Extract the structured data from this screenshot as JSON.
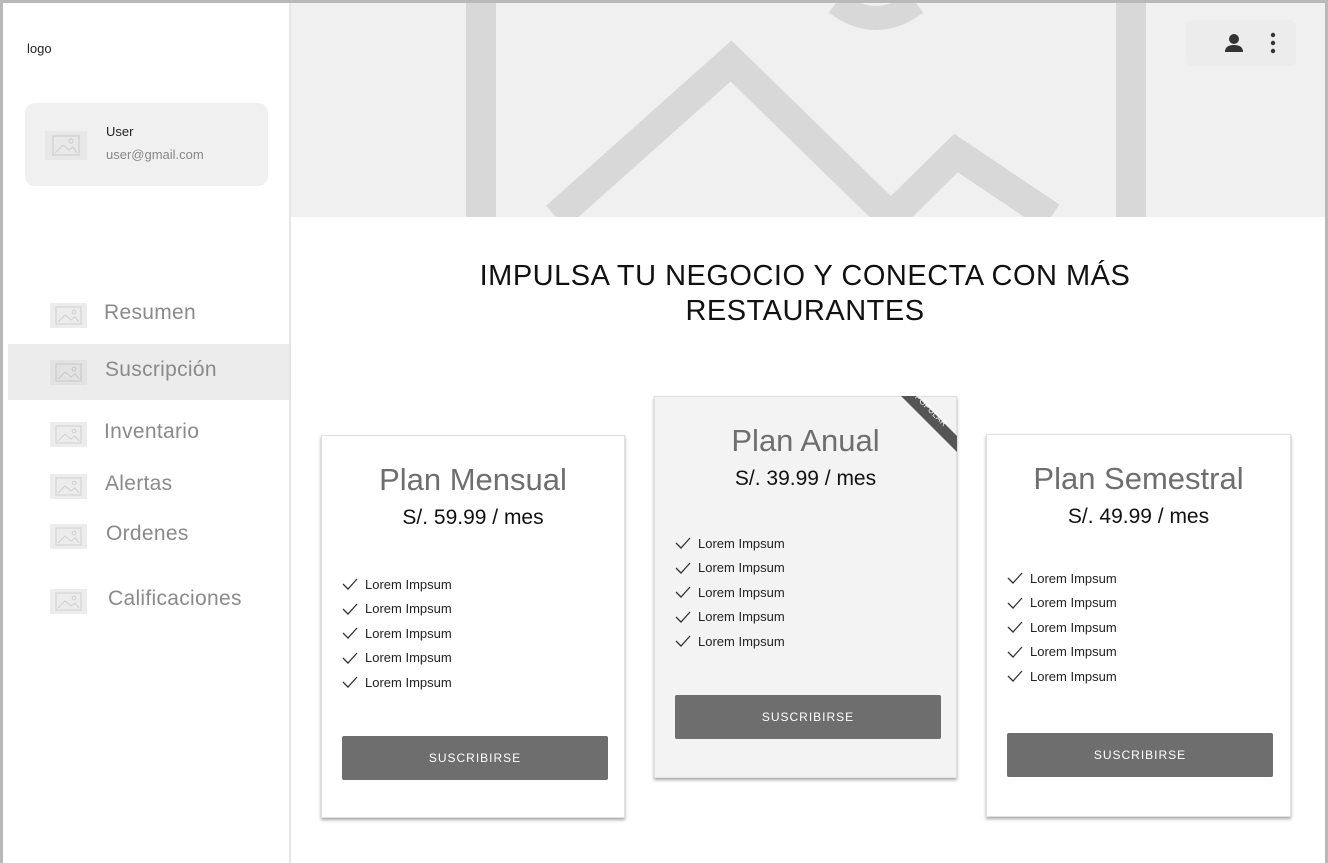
{
  "sidebar": {
    "logo": "logo",
    "user": {
      "name": "User",
      "email": "user@gmail.com"
    },
    "items": [
      {
        "label": "Resumen",
        "active": false
      },
      {
        "label": "Suscripción",
        "active": true
      },
      {
        "label": "Inventario",
        "active": false
      },
      {
        "label": "Alertas",
        "active": false
      },
      {
        "label": "Ordenes",
        "active": false
      },
      {
        "label": "Calificaciones",
        "active": false
      }
    ]
  },
  "header": {
    "icons": [
      "user-icon",
      "more-vertical-icon"
    ]
  },
  "main": {
    "headline": "IMPULSA TU NEGOCIO Y CONECTA CON MÁS RESTAURANTES",
    "plans": [
      {
        "name": "Plan Mensual",
        "price": "S/. 59.99 / mes",
        "features": [
          "Lorem Impsum",
          "Lorem Impsum",
          "Lorem Impsum",
          "Lorem Impsum",
          "Lorem Impsum"
        ],
        "button": "SUSCRIBIRSE"
      },
      {
        "name": "Plan Anual",
        "price": "S/. 39.99 / mes",
        "badge": "POPULAR",
        "features": [
          "Lorem Impsum",
          "Lorem Impsum",
          "Lorem Impsum",
          "Lorem Impsum",
          "Lorem Impsum"
        ],
        "button": "SUSCRIBIRSE"
      },
      {
        "name": "Plan Semestral",
        "price": "S/. 49.99 / mes",
        "features": [
          "Lorem Impsum",
          "Lorem Impsum",
          "Lorem Impsum",
          "Lorem Impsum",
          "Lorem Impsum"
        ],
        "button": "SUSCRIBIRSE"
      }
    ]
  },
  "colors": {
    "button": "#6e6e6e",
    "active_nav": "#ececec",
    "banner": "#f0f0f0"
  }
}
